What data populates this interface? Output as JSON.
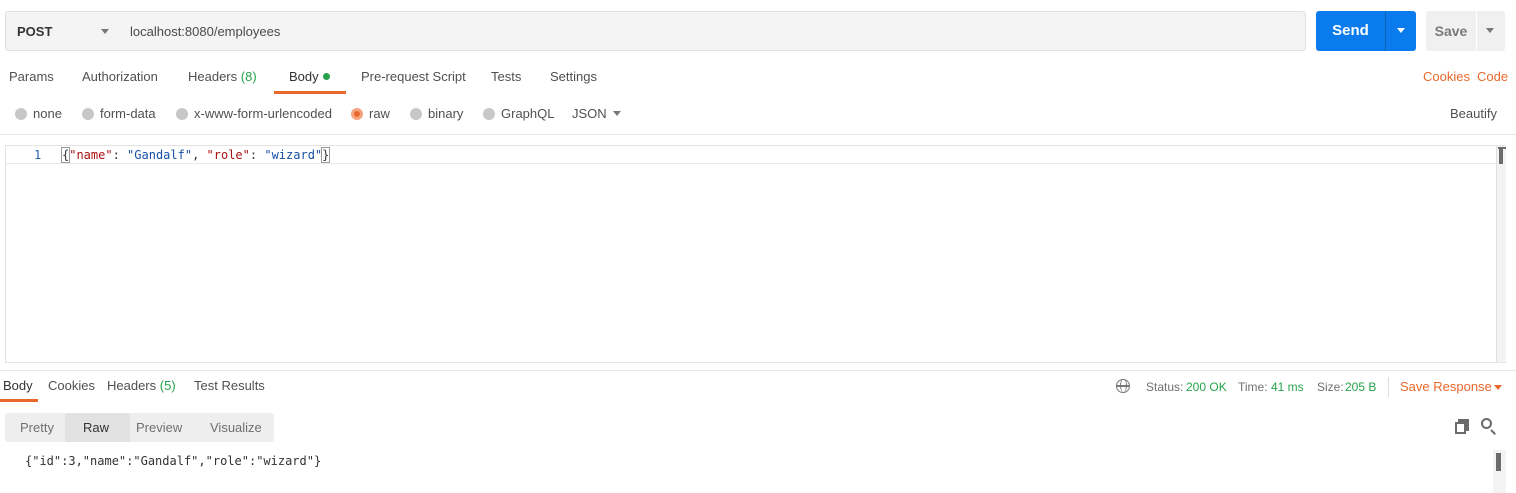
{
  "request": {
    "method": "POST",
    "url": "localhost:8080/employees",
    "send_label": "Send",
    "save_label": "Save"
  },
  "request_tabs": [
    {
      "label": "Params"
    },
    {
      "label": "Authorization"
    },
    {
      "label": "Headers",
      "count": "(8)"
    },
    {
      "label": "Body"
    },
    {
      "label": "Pre-request Script"
    },
    {
      "label": "Tests"
    },
    {
      "label": "Settings"
    }
  ],
  "right_links": {
    "cookies": "Cookies",
    "code": "Code",
    "beautify": "Beautify"
  },
  "body_types": [
    "none",
    "form-data",
    "x-www-form-urlencoded",
    "raw",
    "binary",
    "GraphQL"
  ],
  "body_format": "JSON",
  "editor": {
    "line_number": "1",
    "key1": "\"name\"",
    "val1": "\"Gandalf\"",
    "key2": "\"role\"",
    "val2": "\"wizard\""
  },
  "response_tabs": [
    {
      "label": "Body"
    },
    {
      "label": "Cookies"
    },
    {
      "label": "Headers",
      "count": "(5)"
    },
    {
      "label": "Test Results"
    }
  ],
  "status": {
    "status_label": "Status:",
    "status_value": "200 OK",
    "time_label": "Time:",
    "time_value": "41 ms",
    "size_label": "Size:",
    "size_value": "205 B",
    "save_response": "Save Response"
  },
  "view_modes": [
    "Pretty",
    "Raw",
    "Preview",
    "Visualize"
  ],
  "response_body": "{\"id\":3,\"name\":\"Gandalf\",\"role\":\"wizard\"}",
  "colors": {
    "accent": "#e8682c",
    "send": "#097bed",
    "success": "#26a34a"
  }
}
